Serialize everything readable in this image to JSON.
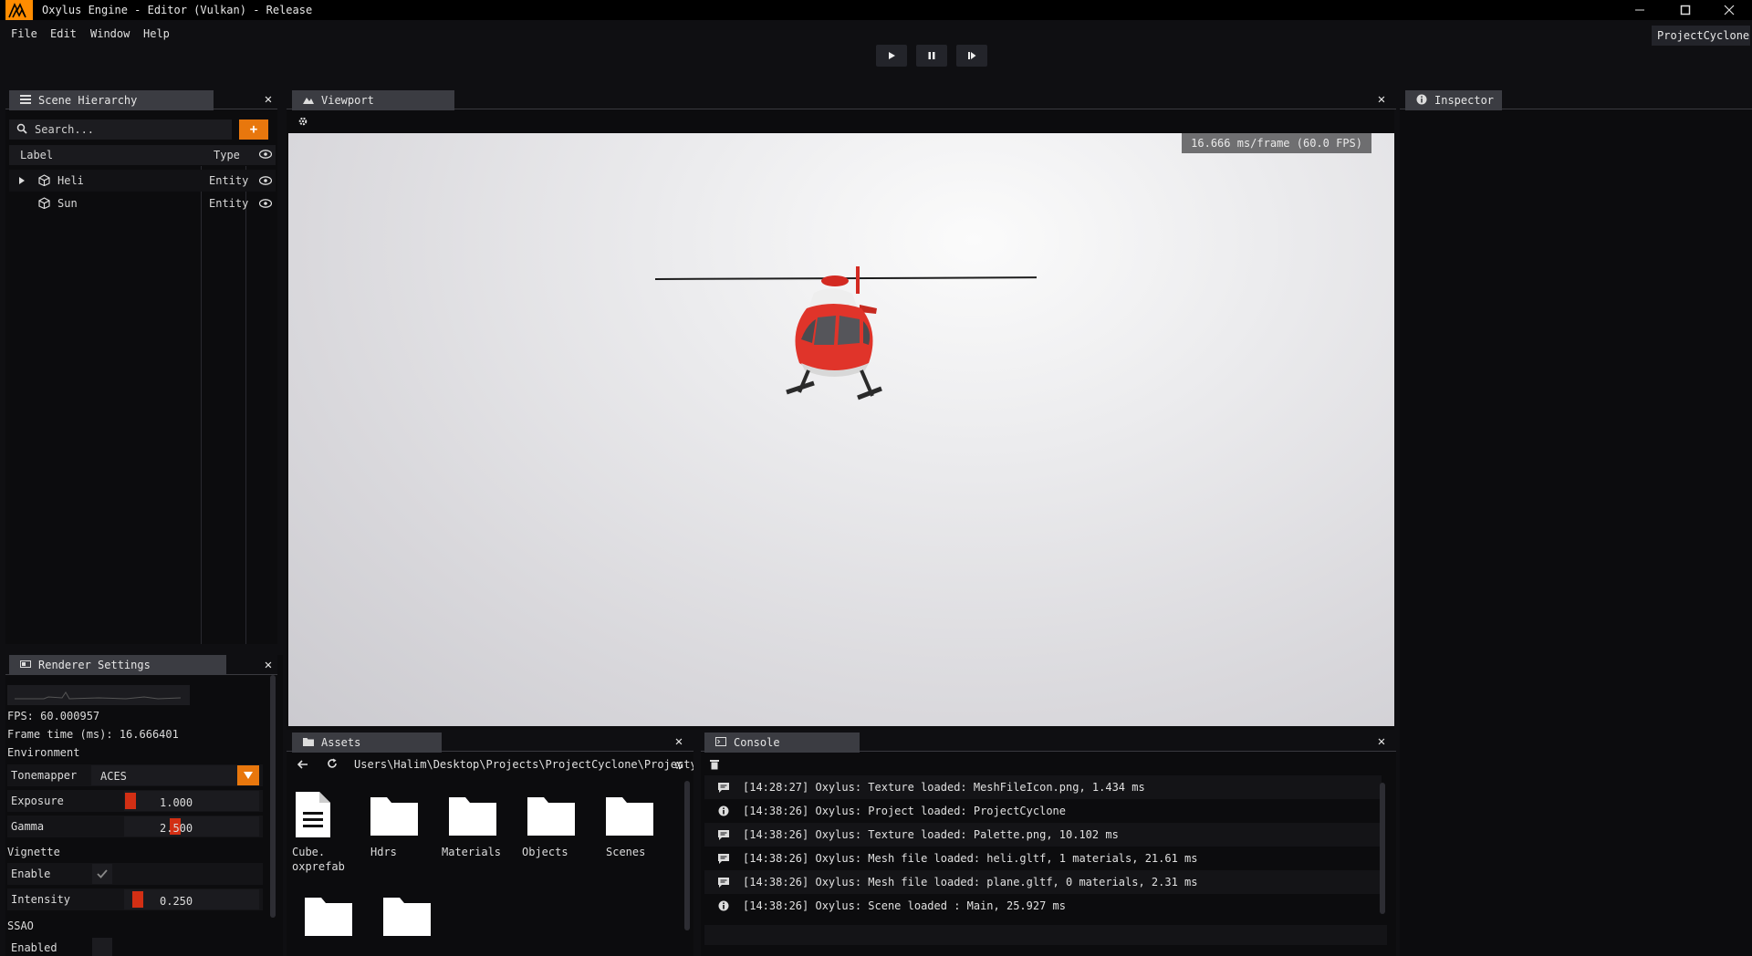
{
  "window": {
    "title": "Oxylus Engine - Editor (Vulkan) - Release",
    "project_name": "ProjectCyclone"
  },
  "menu": [
    "File",
    "Edit",
    "Window",
    "Help"
  ],
  "hierarchy": {
    "tab_label": "Scene Hierarchy",
    "search_placeholder": "Search...",
    "add_label": "+",
    "col_label": "Label",
    "col_type": "Type",
    "rows": [
      {
        "label": "Heli",
        "type": "Entity"
      },
      {
        "label": "Sun",
        "type": "Entity"
      }
    ]
  },
  "viewport": {
    "tab_label": "Viewport",
    "fps_text": "16.666 ms/frame (60.0 FPS)"
  },
  "inspector": {
    "tab_label": "Inspector"
  },
  "renderer": {
    "tab_label": "Renderer Settings",
    "fps_line": "FPS: 60.000957",
    "frame_time_line": "Frame time (ms): 16.666401",
    "section_environment": "Environment",
    "tonemapper_label": "Tonemapper",
    "tonemapper_value": "ACES",
    "exposure_label": "Exposure",
    "exposure_value": "1.000",
    "gamma_label": "Gamma",
    "gamma_value": "2.500",
    "section_vignette": "Vignette",
    "vignette_enable_label": "Enable",
    "vignette_intensity_label": "Intensity",
    "vignette_intensity_value": "0.250",
    "section_ssao": "SSAO",
    "ssao_enabled_label": "Enabled",
    "accent": "#d22f14"
  },
  "assets": {
    "tab_label": "Assets",
    "path": "Users\\Halim\\Desktop\\Projects\\ProjectCyclone\\Projecty",
    "items": [
      {
        "name": "Cube.\noxprefab",
        "kind": "file"
      },
      {
        "name": "Hdrs",
        "kind": "folder"
      },
      {
        "name": "Materials",
        "kind": "folder"
      },
      {
        "name": "Objects",
        "kind": "folder"
      },
      {
        "name": "Scenes",
        "kind": "folder"
      },
      {
        "name": "",
        "kind": "folder"
      },
      {
        "name": "",
        "kind": "folder"
      }
    ]
  },
  "console": {
    "tab_label": "Console",
    "lines": [
      {
        "icon": "message",
        "text": "[14:28:27] Oxylus: Texture loaded: MeshFileIcon.png, 1.434 ms"
      },
      {
        "icon": "info",
        "text": "[14:38:26] Oxylus: Project loaded: ProjectCyclone"
      },
      {
        "icon": "message",
        "text": "[14:38:26] Oxylus: Texture loaded: Palette.png, 10.102 ms"
      },
      {
        "icon": "message",
        "text": "[14:38:26] Oxylus: Mesh file loaded: heli.gltf, 1 materials, 21.61 ms"
      },
      {
        "icon": "message",
        "text": "[14:38:26] Oxylus: Mesh file loaded: plane.gltf, 0 materials, 2.31 ms"
      },
      {
        "icon": "info",
        "text": "[14:38:26] Oxylus: Scene loaded : Main, 25.927 ms"
      }
    ]
  },
  "colors": {
    "brand": "#ff8c00",
    "accent_orange": "#e8770d"
  }
}
